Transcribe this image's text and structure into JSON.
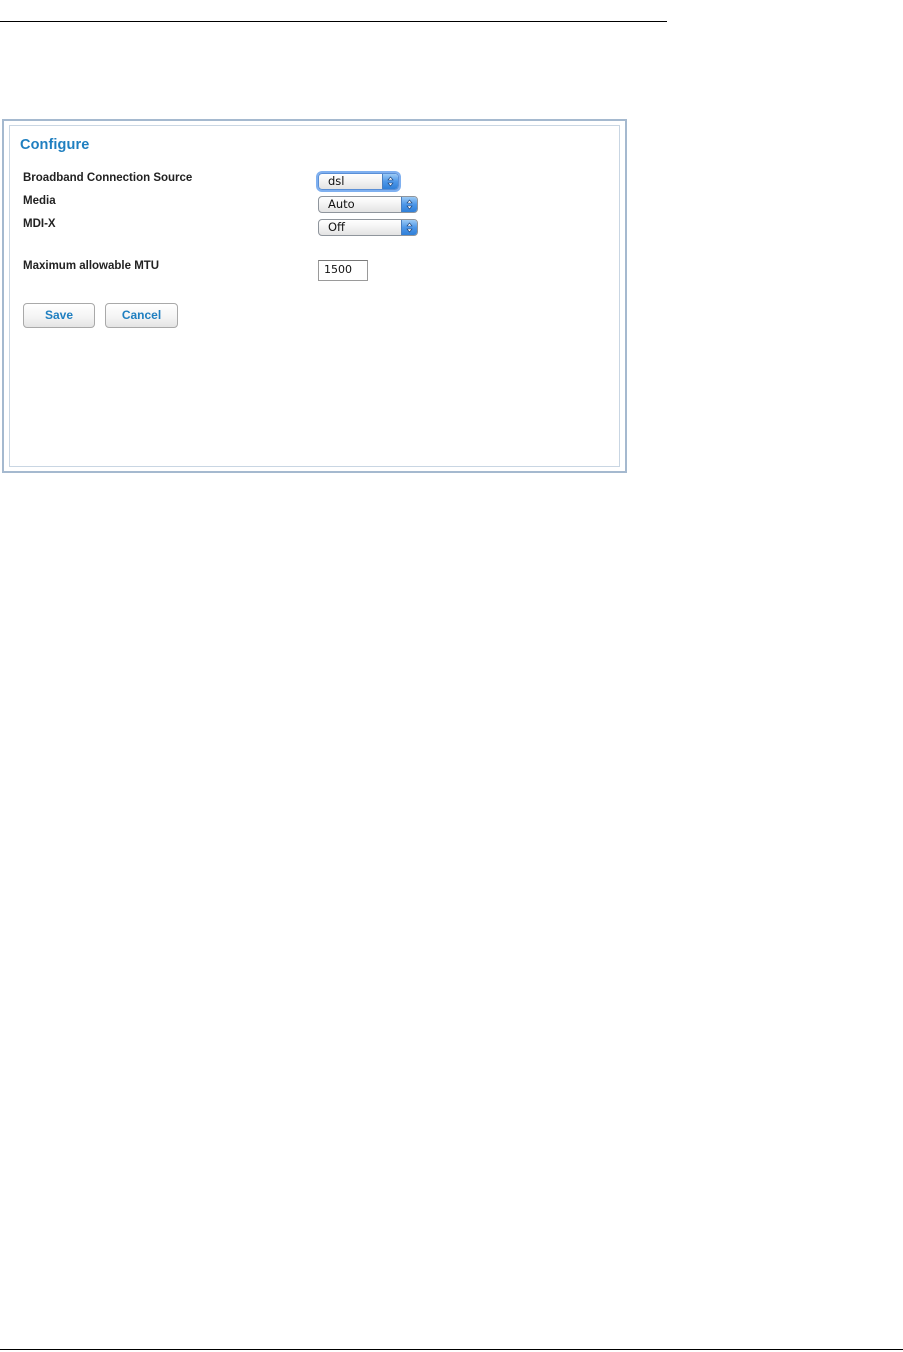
{
  "panel": {
    "title": "Configure"
  },
  "form": {
    "broadband_source": {
      "label": "Broadband Connection Source",
      "value": "dsl"
    },
    "media": {
      "label": "Media",
      "value": "Auto"
    },
    "mdix": {
      "label": "MDI-X",
      "value": "Off"
    },
    "mtu": {
      "label": "Maximum allowable MTU",
      "value": "1500"
    }
  },
  "buttons": {
    "save_label": "Save",
    "cancel_label": "Cancel"
  },
  "colors": {
    "accent": "#1f7fc0",
    "panel_border": "#a5b9cf",
    "select_arrow": "#4d97e8"
  },
  "icons": {
    "select_arrows": "up-down-chevron-icon"
  }
}
